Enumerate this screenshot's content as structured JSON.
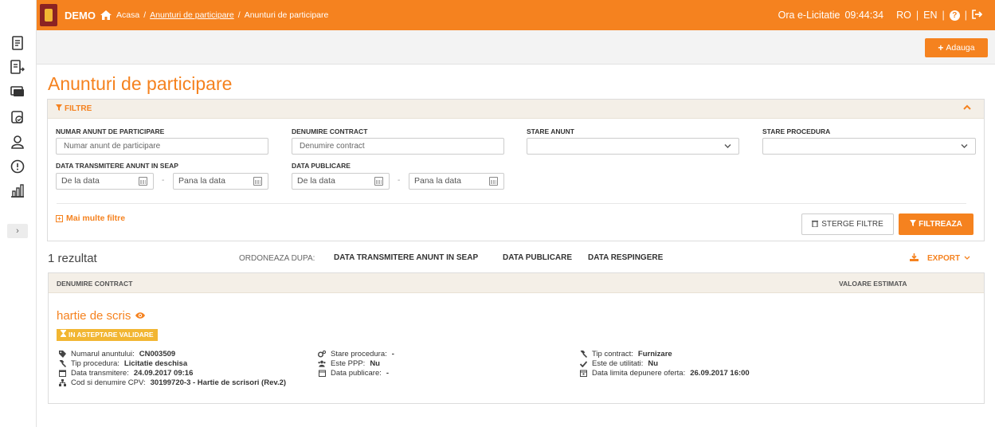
{
  "topbar": {
    "brand": "DEMO",
    "breadcrumbs": [
      "Acasa",
      "Anunturi de participare",
      "Anunturi de participare"
    ],
    "clock_label": "Ora e-Licitatie",
    "clock_time": "09:44:34",
    "lang_ro": "RO",
    "lang_en": "EN",
    "accent_color": "#f5821f"
  },
  "actionbar": {
    "add_label": "Adauga"
  },
  "page_title": "Anunturi de participare",
  "filters": {
    "header": "FILTRE",
    "numar_label": "NUMAR ANUNT DE PARTICIPARE",
    "numar_placeholder": "Numar anunt de participare",
    "denumire_label": "DENUMIRE CONTRACT",
    "denumire_placeholder": "Denumire contract",
    "stare_anunt_label": "STARE ANUNT",
    "stare_anunt_value": "",
    "stare_procedura_label": "STARE PROCEDURA",
    "stare_procedura_value": "",
    "data_transmitere_label": "DATA TRANSMITERE ANUNT IN SEAP",
    "data_publicare_label": "DATA PUBLICARE",
    "from_placeholder": "De la data",
    "to_placeholder": "Pana la data",
    "dash": "-",
    "more_filters": "Mai multe filtre",
    "clear_label": "STERGE FILTRE",
    "filter_label": "FILTREAZA"
  },
  "results": {
    "count": "1 rezultat",
    "order_by_label": "ORDONEAZA DUPA:",
    "order_options": [
      "DATA TRANSMITERE ANUNT IN SEAP",
      "DATA PUBLICARE",
      "DATA RESPINGERE"
    ],
    "export_label": "EXPORT",
    "col_denumire": "DENUMIRE CONTRACT",
    "col_valoare": "VALOARE ESTIMATA",
    "items": [
      {
        "title": "hartie de scris",
        "status_badge": "IN ASTEPTARE VALIDARE",
        "numar_label": "Numarul anuntului:",
        "numar_value": "CN003509",
        "tip_procedura_label": "Tip procedura:",
        "tip_procedura_value": "Licitatie deschisa",
        "data_transmitere_label": "Data transmitere:",
        "data_transmitere_value": "24.09.2017 09:16",
        "cpv_label": "Cod si denumire CPV:",
        "cpv_value": "30199720-3 - Hartie de scrisori (Rev.2)",
        "stare_procedura_label": "Stare procedura:",
        "stare_procedura_value": "-",
        "este_ppp_label": "Este PPP:",
        "este_ppp_value": "Nu",
        "data_publicare_label": "Data publicare:",
        "data_publicare_value": "-",
        "tip_contract_label": "Tip contract:",
        "tip_contract_value": "Furnizare",
        "utilitati_label": "Este de utilitati:",
        "utilitati_value": "Nu",
        "data_limita_label": "Data limita depunere oferta:",
        "data_limita_value": "26.09.2017 16:00"
      }
    ]
  }
}
